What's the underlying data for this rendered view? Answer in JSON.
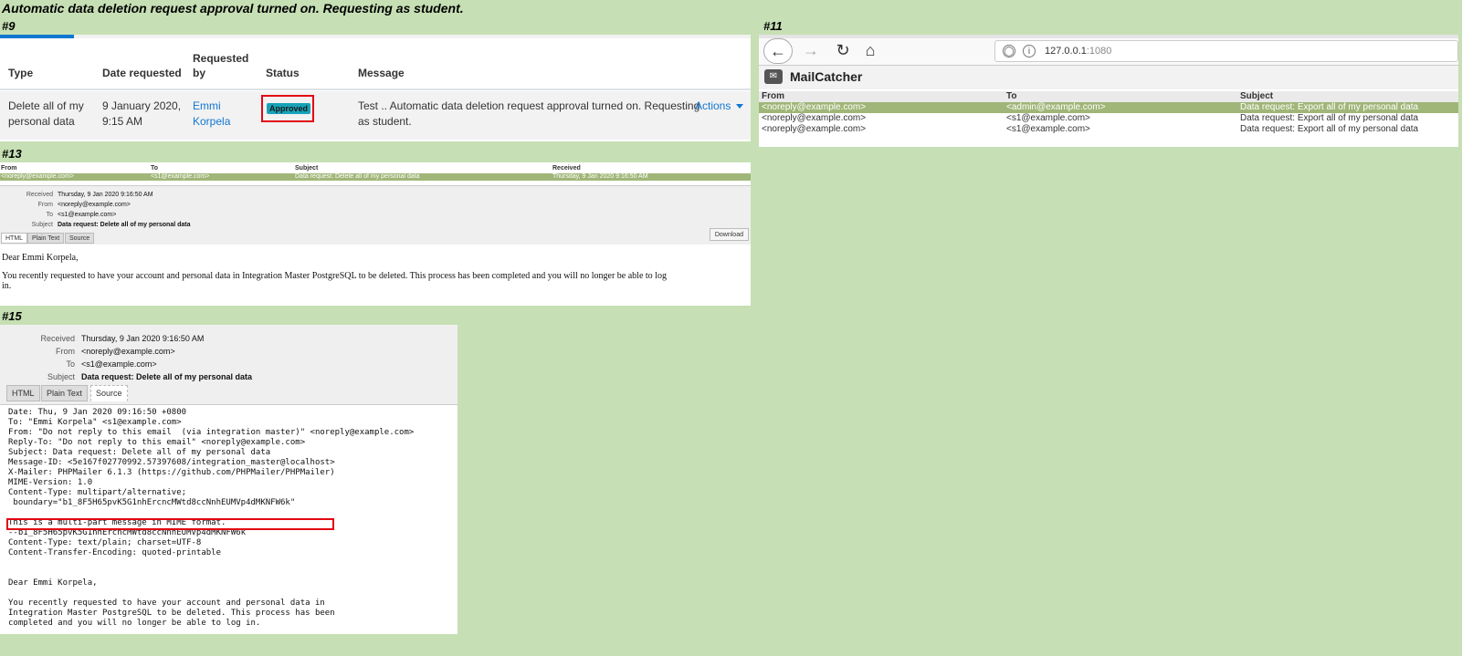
{
  "headline": "Automatic data deletion request approval turned on. Requesting as student.",
  "panels": {
    "p9": {
      "label": "#9",
      "columns": [
        "Type",
        "Date requested",
        "Requested by",
        "Status",
        "Message"
      ],
      "requested_by_header": [
        "Requested",
        "by"
      ],
      "row": {
        "type": [
          "Delete all of my",
          "personal data"
        ],
        "date": [
          "9 January 2020,",
          "9:15 AM"
        ],
        "requested_by": [
          "Emmi",
          "Korpela"
        ],
        "status": "Approved",
        "message": [
          "Test .. Automatic data deletion request approval turned on. Requesting",
          "as student."
        ],
        "actions": "Actions"
      }
    },
    "p11": {
      "label": "#11",
      "url_host": "127.0.0.1",
      "url_port": ":1080",
      "app_title": "MailCatcher",
      "headers": [
        "From",
        "To",
        "Subject"
      ],
      "rows": [
        {
          "from": "<noreply@example.com>",
          "to": "<admin@example.com>",
          "subject": "Data request: Export all of my personal data",
          "selected": true
        },
        {
          "from": "<noreply@example.com>",
          "to": "<s1@example.com>",
          "subject": "Data request: Export all of my personal data",
          "selected": false
        },
        {
          "from": "<noreply@example.com>",
          "to": "<s1@example.com>",
          "subject": "Data request: Export all of my personal data",
          "selected": false
        }
      ]
    },
    "p13": {
      "label": "#13",
      "headers": [
        "From",
        "To",
        "Subject",
        "Received"
      ],
      "selected_row": {
        "from": "<noreply@example.com>",
        "to": "<s1@example.com>",
        "subject": "Data request: Delete all of my personal data",
        "received": "Thursday, 9 Jan 2020 9:16:50 AM"
      },
      "meta": {
        "received_label": "Received",
        "received": "Thursday, 9 Jan 2020 9:16:50 AM",
        "from_label": "From",
        "from": "<noreply@example.com>",
        "to_label": "To",
        "to": "<s1@example.com>",
        "subject_label": "Subject",
        "subject": "Data request: Delete all of my personal data"
      },
      "tabs": [
        "HTML",
        "Plain Text",
        "Source"
      ],
      "download": "Download",
      "greeting": "Dear Emmi Korpela,",
      "body": [
        "You recently requested to have your account and personal data in Integration Master PostgreSQL to be deleted. This process has been completed and you will no longer be able to log",
        "in."
      ]
    },
    "p15": {
      "label": "#15",
      "meta": {
        "received_label": "Received",
        "received": "Thursday, 9 Jan 2020 9:16:50 AM",
        "from_label": "From",
        "from": "<noreply@example.com>",
        "to_label": "To",
        "to": "<s1@example.com>",
        "subject_label": "Subject",
        "subject": "Data request: Delete all of my personal data"
      },
      "tabs": [
        "HTML",
        "Plain Text",
        "Source"
      ],
      "source_lines": [
        "Date: Thu, 9 Jan 2020 09:16:50 +0800",
        "To: \"Emmi Korpela\" <s1@example.com>",
        "From: \"Do not reply to this email  (via integration master)\" <noreply@example.com>",
        "Reply-To: \"Do not reply to this email\" <noreply@example.com>",
        "Subject: Data request: Delete all of my personal data",
        "Message-ID: <5e167f02770992.57397608/integration_master@localhost>",
        "X-Mailer: PHPMailer 6.1.3 (https://github.com/PHPMailer/PHPMailer)",
        "MIME-Version: 1.0",
        "Content-Type: multipart/alternative;",
        " boundary=\"b1_8F5H65pvK5G1nhErcncMWtd8ccNnhEUMVp4dMKNFW6k\"",
        "",
        "This is a multi-part message in MIME format.",
        "--b1_8F5H65pvK5G1nhErcncMWtd8ccNnhEUMVp4dMKNFW6k",
        "Content-Type: text/plain; charset=UTF-8",
        "Content-Transfer-Encoding: quoted-printable",
        "",
        "",
        "Dear Emmi Korpela,",
        "",
        "You recently requested to have your account and personal data in",
        "Integration Master PostgreSQL to be deleted. This process has been",
        "completed and you will no longer be able to log in."
      ]
    }
  },
  "colors": {
    "background": "#c6dfb4",
    "highlight": "#e30613",
    "selected_row": "#a0b678",
    "link": "#1177d1",
    "badge": "#17a2b8"
  },
  "icons": [
    "back-arrow-icon",
    "forward-arrow-icon",
    "reload-icon",
    "home-icon",
    "shield-icon",
    "info-icon",
    "mailcatcher-logo-icon",
    "caret-down-icon"
  ]
}
